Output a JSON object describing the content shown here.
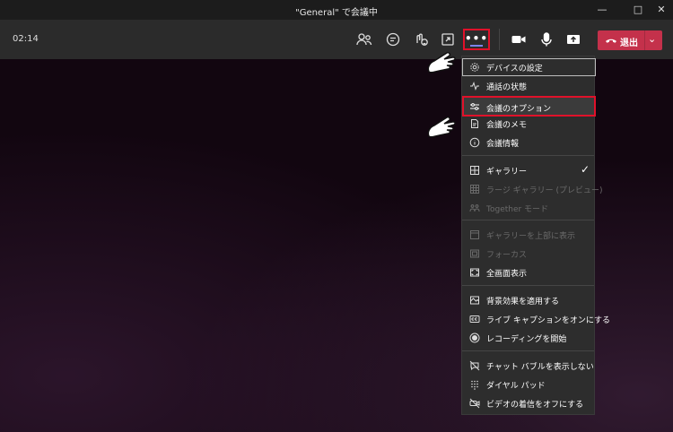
{
  "window": {
    "title": "\"General\" で会議中",
    "controls": [
      "minimize-icon",
      "maximize-icon",
      "close-icon"
    ]
  },
  "toolbar": {
    "timer": "02:14",
    "buttons": [
      "people-icon",
      "chat-icon",
      "reactions-icon",
      "share-tray-icon",
      "more-actions-icon",
      "camera-icon",
      "mic-icon",
      "share-screen-icon"
    ],
    "more_label": "•••",
    "leave_label": "退出"
  },
  "menu": {
    "items": [
      {
        "label": "デバイスの設定",
        "icon": "gear-icon",
        "state": "boxed"
      },
      {
        "label": "通話の状態",
        "icon": "pulse-icon"
      },
      {
        "label": "会議のオプション",
        "icon": "sliders-icon",
        "state": "highlighted"
      },
      {
        "label": "会議のメモ",
        "icon": "notes-icon"
      },
      {
        "label": "会議情報",
        "icon": "info-icon"
      },
      {
        "label": "ギャラリー",
        "icon": "grid-icon",
        "checked": true
      },
      {
        "label": "ラージ ギャラリー (プレビュー)",
        "icon": "large-grid-icon",
        "disabled": true
      },
      {
        "label": "Together モード",
        "icon": "together-icon",
        "disabled": true
      },
      {
        "label": "ギャラリーを上部に表示",
        "icon": "gallery-top-icon",
        "disabled": true
      },
      {
        "label": "フォーカス",
        "icon": "focus-icon",
        "disabled": true
      },
      {
        "label": "全画面表示",
        "icon": "fullscreen-icon"
      },
      {
        "label": "背景効果を適用する",
        "icon": "background-icon"
      },
      {
        "label": "ライブ キャプションをオンにする",
        "icon": "cc-icon"
      },
      {
        "label": "レコーディングを開始",
        "icon": "record-icon"
      },
      {
        "label": "チャット バブルを表示しない",
        "icon": "chat-bubble-off-icon"
      },
      {
        "label": "ダイヤル パッド",
        "icon": "dialpad-icon"
      },
      {
        "label": "ビデオの着信をオフにする",
        "icon": "video-off-icon"
      }
    ],
    "check_glyph": "✓"
  },
  "colors": {
    "accent_red": "#e0112a",
    "leave_red": "#c4314b",
    "active_underline": "#7b83eb"
  }
}
